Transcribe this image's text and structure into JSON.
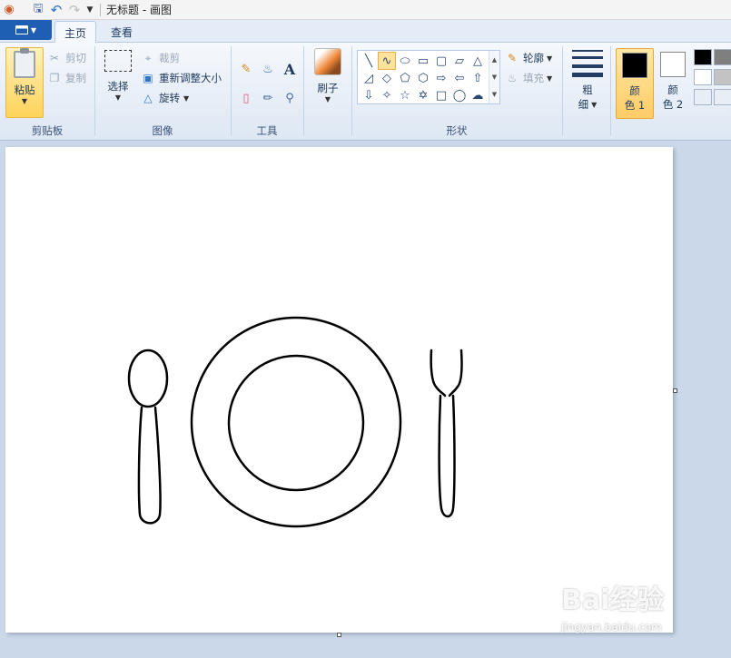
{
  "window": {
    "title": "无标题 - 画图"
  },
  "quick_access": {
    "app_icon": "paint-palette-icon",
    "save_icon": "save-icon",
    "undo_icon": "undo-icon",
    "redo_icon": "redo-icon",
    "customize_icon": "customize-quick-access-icon"
  },
  "tabs": {
    "file_menu_icon": "paint-menu-icon",
    "items": [
      {
        "label": "主页",
        "active": true
      },
      {
        "label": "查看",
        "active": false
      }
    ]
  },
  "ribbon": {
    "clipboard": {
      "group_label": "剪贴板",
      "paste": "粘贴",
      "cut": "剪切",
      "copy": "复制"
    },
    "image": {
      "group_label": "图像",
      "select": "选择",
      "crop": "裁剪",
      "resize": "重新调整大小",
      "rotate": "旋转"
    },
    "tools": {
      "group_label": "工具",
      "items": [
        "pencil-icon",
        "fill-bucket-icon",
        "text-icon",
        "eraser-icon",
        "color-picker-icon",
        "magnifier-icon"
      ],
      "text_glyph": "A"
    },
    "brushes": {
      "label": "刷子"
    },
    "shapes": {
      "group_label": "形状",
      "outline": "轮廓",
      "fill": "填充",
      "selected_index": 1,
      "items": [
        "line",
        "curve",
        "oval",
        "rectangle",
        "rounded-rectangle",
        "polygon",
        "triangle",
        "right-triangle",
        "diamond",
        "pentagon",
        "hexagon",
        "right-arrow",
        "left-arrow",
        "up-arrow",
        "down-arrow",
        "four-point-star",
        "five-point-star",
        "six-point-star",
        "rounded-callout",
        "oval-callout",
        "cloud-callout"
      ]
    },
    "size": {
      "label_line1": "粗",
      "label_line2": "细"
    },
    "colors": {
      "color1_line1": "颜",
      "color1_line2": "色 1",
      "color1_value": "#000000",
      "color2_line1": "颜",
      "color2_line2": "色 2",
      "color2_value": "#ffffff",
      "palette": [
        "#000000",
        "#7f7f7f",
        "#ffffff",
        "#c3c3c3",
        "#e8eef6",
        "#e8eef6"
      ]
    }
  },
  "canvas": {
    "background": "#ffffff",
    "stroke_color": "#000000",
    "drawing_items": [
      "spoon",
      "plate",
      "fork"
    ]
  },
  "watermark": {
    "logo": "Bai经验",
    "url": "jingyan.baidu.com"
  }
}
